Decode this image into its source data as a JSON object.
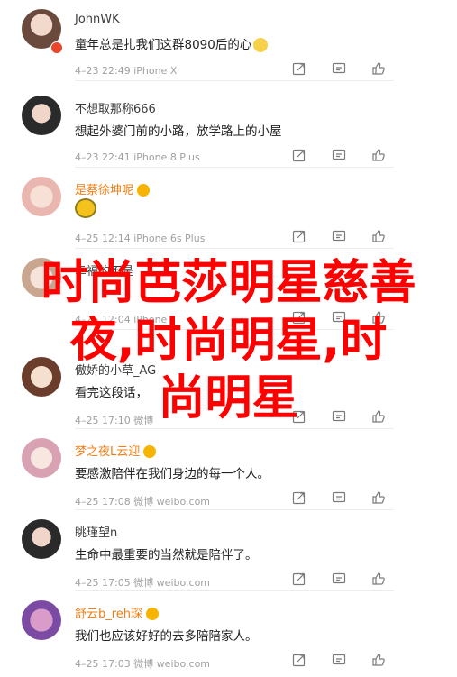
{
  "comments": [
    {
      "name": "JohnWK",
      "text": "童年总是扎我们这群8090后的心",
      "meta": "4–23 22:49 iPhone X",
      "name_color": "#3b3b3b"
    },
    {
      "name": "不想取那称666",
      "text": "想起外婆门前的小路，放学路上的小屋",
      "meta": "4–23 22:41 iPhone 8 Plus",
      "name_color": "#3b3b3b"
    },
    {
      "name": "是蔡徐坤呢",
      "text": "",
      "meta": "4–25 12:14 iPhone 6s Plus",
      "name_color": "#f07d13"
    },
    {
      "name": "幸福的不是",
      "text": "",
      "meta": "4–25 12:04 iPhone",
      "name_color": "#3b3b3b"
    },
    {
      "name": "傲娇的小草_AG",
      "text": "看完这段话，",
      "meta": "4–25 17:10 微博",
      "name_color": "#3b3b3b"
    },
    {
      "name": "梦之夜L云迎",
      "text": "要感激陪伴在我们身边的每一个人。",
      "meta": "4–25 17:08 微博 weibo.com",
      "name_color": "#f07d13"
    },
    {
      "name": "眺瑾望n",
      "text": "生命中最重要的当然就是陪伴了。",
      "meta": "4–25 17:05 微博 weibo.com",
      "name_color": "#3b3b3b"
    },
    {
      "name": "舒云b_reh琛",
      "text": "我们也应该好好的去多陪陪家人。",
      "meta": "4–25 17:03 微博 weibo.com",
      "name_color": "#f07d13"
    }
  ],
  "overlay": {
    "line1": "时尚芭莎明星慈善",
    "line2": "夜,时尚明星,时",
    "line3": "尚明星"
  },
  "icons": [
    "share-icon",
    "comment-icon",
    "like-icon"
  ]
}
